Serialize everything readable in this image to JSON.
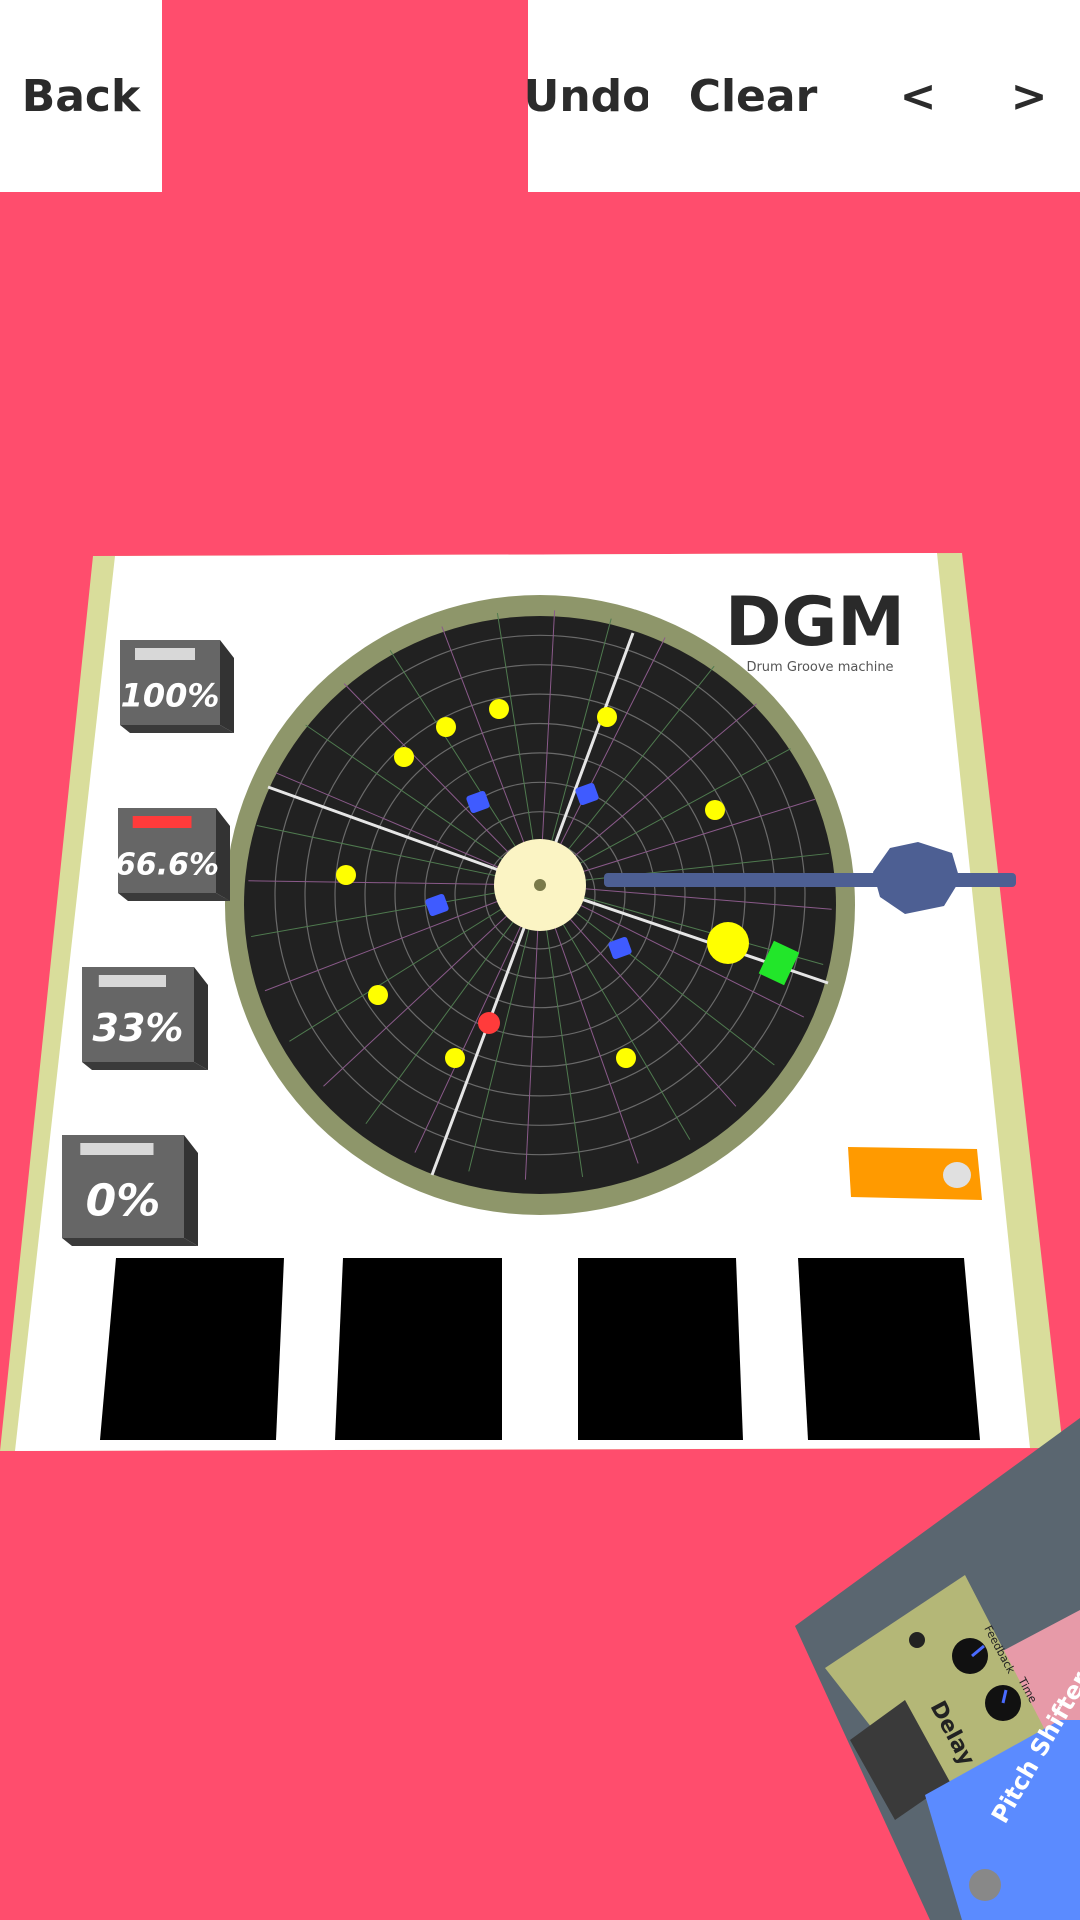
{
  "toolbar": {
    "back_label": "Back",
    "undo_label": "Undo",
    "clear_label": "Clear",
    "prev_label": "<",
    "next_label": ">"
  },
  "machine": {
    "logo": "DGM",
    "subtitle": "Drum Groove machine"
  },
  "volume_buttons": [
    {
      "label": "100%",
      "selected": false
    },
    {
      "label": "66.6%",
      "selected": true
    },
    {
      "label": "33%",
      "selected": false
    },
    {
      "label": "0%",
      "selected": false
    }
  ],
  "pads": [
    "",
    "",
    "",
    ""
  ],
  "pedals": {
    "delay": {
      "label": "Delay",
      "knob1": "Feedback",
      "knob2": "Time"
    },
    "pitch": {
      "label": "Pitch Shifter"
    }
  },
  "colors": {
    "background": "#ff4d6d",
    "board": "#ffffff",
    "board_edge": "#d9dd9b",
    "disc": "#212121",
    "disc_rim": "#8e966a",
    "note_yellow": "#ffff00",
    "note_blue": "#3f5bff",
    "note_red": "#ff3b3b",
    "note_green": "#22e62a",
    "arm": "#4d5f93",
    "toggle": "#ff9a00",
    "selected_indicator": "#ff3b3b"
  }
}
